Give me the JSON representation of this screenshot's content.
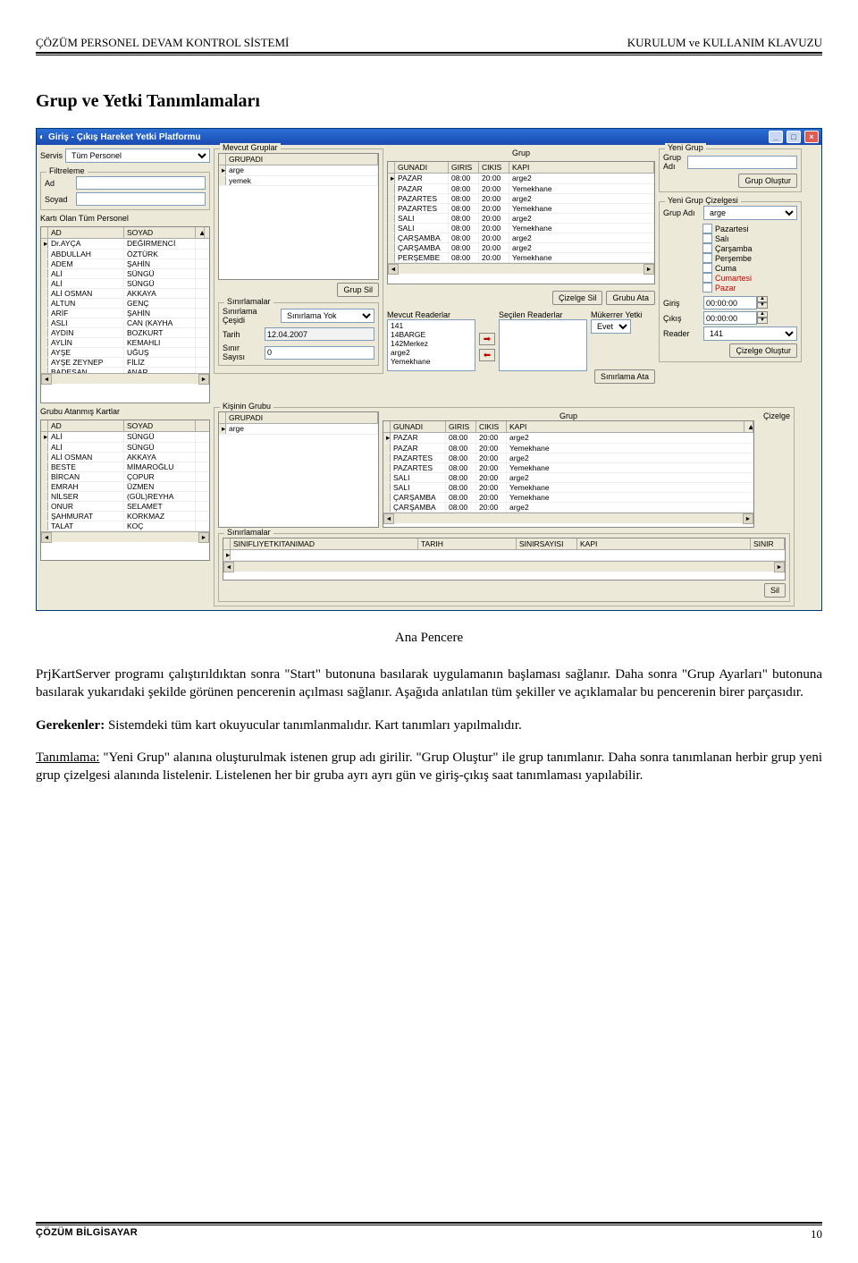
{
  "header": {
    "left": "ÇÖZÜM PERSONEL DEVAM  KONTROL SİSTEMİ",
    "right": "KURULUM ve KULLANIM KLAVUZU"
  },
  "title": "Grup ve Yetki Tanımlamaları",
  "win": {
    "title": "Giriş - Çıkış Hareket Yetki Platformu",
    "servis_lbl": "Servis",
    "servis_val": "Tüm Personel",
    "filtreleme_title": "Filtreleme",
    "ad_lbl": "Ad",
    "soyad_lbl": "Soyad",
    "kart_olan_title": "Kartı Olan Tüm Personel",
    "personel_cols": [
      "AD",
      "SOYAD"
    ],
    "personel": [
      [
        "Dr.AYÇA",
        "DEĞİRMENCİ"
      ],
      [
        "ABDULLAH",
        "ÖZTÜRK"
      ],
      [
        "ADEM",
        "ŞAHİN"
      ],
      [
        "ALİ",
        "SÜNGÜ"
      ],
      [
        "ALİ",
        "SÜNGÜ"
      ],
      [
        "ALİ OSMAN",
        "AKKAYA"
      ],
      [
        "ALTUN",
        "GENÇ"
      ],
      [
        "ARİF",
        "ŞAHİN"
      ],
      [
        "ASLI",
        "CAN (KAYHA"
      ],
      [
        "AYDIN",
        "BOZKURT"
      ],
      [
        "AYLİN",
        "KEMAHLI"
      ],
      [
        "AYŞE",
        "UĞUŞ"
      ],
      [
        "AYŞE ZEYNEP",
        "FİLİZ"
      ],
      [
        "BADESAN",
        "ANAR"
      ]
    ],
    "mevcut_gruplar_title": "Mevcut Gruplar",
    "grup_lbl": "Grup",
    "grup_cols": [
      "GRUPADI"
    ],
    "gruplar": [
      "arge",
      "yemek"
    ],
    "cizelge_cols": [
      "GUNADI",
      "GIRIS",
      "CIKIS",
      "KAPI"
    ],
    "cizelge": [
      [
        "PAZAR",
        "08:00",
        "20:00",
        "arge2"
      ],
      [
        "PAZAR",
        "08:00",
        "20:00",
        "Yemekhane"
      ],
      [
        "PAZARTES",
        "08:00",
        "20:00",
        "arge2"
      ],
      [
        "PAZARTES",
        "08:00",
        "20:00",
        "Yemekhane"
      ],
      [
        "SALI",
        "08:00",
        "20:00",
        "arge2"
      ],
      [
        "SALI",
        "08:00",
        "20:00",
        "Yemekhane"
      ],
      [
        "ÇARŞAMBA",
        "08:00",
        "20:00",
        "arge2"
      ],
      [
        "ÇARŞAMBA",
        "08:00",
        "20:00",
        "arge2"
      ],
      [
        "PERŞEMBE",
        "08:00",
        "20:00",
        "Yemekhane"
      ]
    ],
    "grup_sil_btn": "Grup Sil",
    "cizelge_sil_btn": "Çizelge Sil",
    "grubu_ata_btn": "Grubu Ata",
    "sinirlamalar_title": "Sınırlamalar",
    "sinirlama_cesidi_lbl": "Sınırlama Çeşidi",
    "sinirlama_cesidi_val": "Sınırlama Yok",
    "tarih_lbl": "Tarih",
    "tarih_val": "12.04.2007",
    "sinir_sayisi_lbl": "Sınır Sayısı",
    "sinir_sayisi_val": "0",
    "mevcut_readerlar_lbl": "Mevcut Readerlar",
    "readerlar": [
      "141",
      "14BARGE",
      "142Merkez",
      "arge2",
      "Yemekhane"
    ],
    "secilen_readerlar_lbl": "Seçilen Readerlar",
    "mukerrer_lbl": "Mükerrer Yetki",
    "mukerrer_val": "Evet",
    "sinirlama_ata_btn": "Sınırlama Ata",
    "yeni_grup_title": "Yeni Grup",
    "grup_adi_lbl": "Grup Adı",
    "grup_olustur_btn": "Grup Oluştur",
    "yeni_cizelge_title": "Yeni Grup Çizelgesi",
    "grup_adi_sel": "arge",
    "gunler": [
      "Pazartesi",
      "Salı",
      "Çarşamba",
      "Perşembe",
      "Cuma",
      "Cumartesi",
      "Pazar"
    ],
    "giris_lbl": "Giriş",
    "giris_val": "00:00:00",
    "cikis_lbl": "Çıkış",
    "cikis_val": "00:00:00",
    "reader_lbl": "Reader",
    "reader_val": "141",
    "cizelge_olustur_btn": "Çizelge Oluştur",
    "grubu_atanmis_title": "Grubu Atanmış Kartlar",
    "atanmis_cols": [
      "AD",
      "SOYAD"
    ],
    "atanmis": [
      [
        "ALİ",
        "SÜNGÜ"
      ],
      [
        "ALİ",
        "SÜNGÜ"
      ],
      [
        "ALİ OSMAN",
        "AKKAYA"
      ],
      [
        "BESTE",
        "MİMAROĞLU"
      ],
      [
        "BİRCAN",
        "ÇOPUR"
      ],
      [
        "EMRAH",
        "ÜZMEN"
      ],
      [
        "NİLSER",
        "(GÜL)REYHA"
      ],
      [
        "ONUR",
        "SELAMET"
      ],
      [
        "ŞAHMURAT",
        "KORKMAZ"
      ],
      [
        "TALAT",
        "KOÇ"
      ]
    ],
    "kisinin_grubu_title": "Kişinin Grubu",
    "kg_grup_cols": [
      "GRUPADI"
    ],
    "kg_gruplar": [
      "arge"
    ],
    "kg_cizelge_lbl": "Çizelge",
    "kg_cizelge_cols": [
      "GUNADI",
      "GIRIS",
      "CIKIS",
      "KAPI"
    ],
    "kg_cizelge": [
      [
        "PAZAR",
        "08:00",
        "20:00",
        "arge2"
      ],
      [
        "PAZAR",
        "08:00",
        "20:00",
        "Yemekhane"
      ],
      [
        "PAZARTES",
        "08:00",
        "20:00",
        "arge2"
      ],
      [
        "PAZARTES",
        "08:00",
        "20:00",
        "Yemekhane"
      ],
      [
        "SALI",
        "08:00",
        "20:00",
        "arge2"
      ],
      [
        "SALI",
        "08:00",
        "20:00",
        "Yemekhane"
      ],
      [
        "ÇARŞAMBA",
        "08:00",
        "20:00",
        "Yemekhane"
      ],
      [
        "ÇARŞAMBA",
        "08:00",
        "20:00",
        "arge2"
      ]
    ],
    "sinir_cols": [
      "SINIFLIYETKITANIMAD",
      "TARIH",
      "SINIRSAYISI",
      "KAPI",
      "SINIR"
    ],
    "sil_btn": "Sil"
  },
  "caption": "Ana Pencere",
  "p1": "PrjKartServer programı çalıştırıldıktan sonra \"Start\" butonuna basılarak uygulamanın başlaması sağlanır. Daha sonra \"Grup Ayarları\" butonuna basılarak yukarıdaki şekilde görünen pencerenin açılması sağlanır. Aşağıda anlatılan tüm şekiller ve açıklamalar bu pencerenin birer parçasıdır.",
  "p2_b": "Gerekenler:",
  "p2": " Sistemdeki tüm kart okuyucular tanımlanmalıdır. Kart tanımları yapılmalıdır.",
  "p3_u": "Tanımlama:",
  "p3": " \"Yeni Grup\" alanına oluşturulmak istenen grup adı girilir. \"Grup Oluştur\" ile grup tanımlanır. Daha sonra tanımlanan herbir grup yeni grup çizelgesi alanında listelenir. Listelenen her bir gruba ayrı ayrı gün ve giriş-çıkış saat tanımlaması yapılabilir.",
  "footer": {
    "left": "ÇÖZÜM BİLGİSAYAR",
    "right": "10"
  }
}
